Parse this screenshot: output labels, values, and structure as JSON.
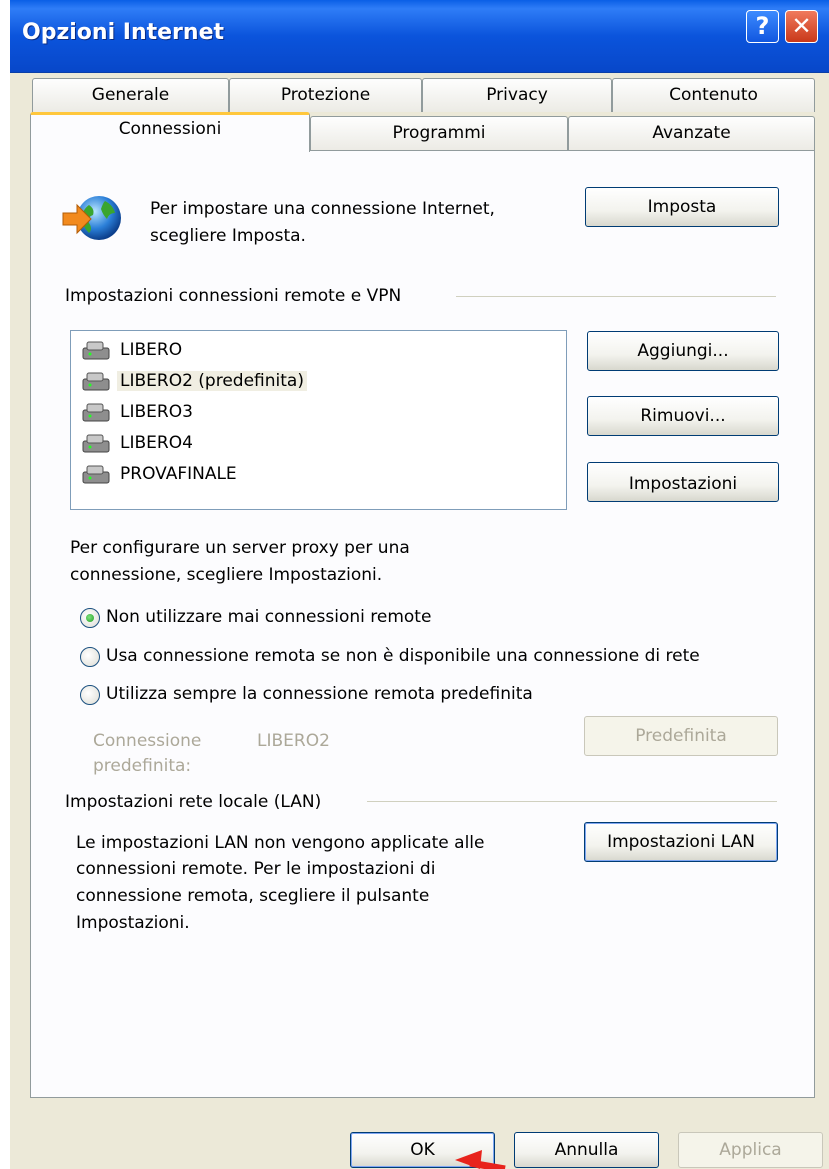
{
  "window": {
    "title": "Opzioni Internet",
    "help_glyph": "?",
    "close_glyph": "✕"
  },
  "tabs": {
    "row1": [
      "Generale",
      "Protezione",
      "Privacy",
      "Contenuto"
    ],
    "row2": [
      "Connessioni",
      "Programmi",
      "Avanzate"
    ],
    "active": "Connessioni"
  },
  "setup": {
    "text_line1": "Per impostare una connessione Internet,",
    "text_line2": "scegliere Imposta.",
    "button": "Imposta"
  },
  "dialup": {
    "group_label": "Impostazioni connessioni remote e VPN",
    "connections": [
      "LIBERO",
      "LIBERO2 (predefinita)",
      "LIBERO3",
      "LIBERO4",
      "PROVAFINALE"
    ],
    "selected": "LIBERO2 (predefinita)",
    "add_button": "Aggiungi...",
    "remove_button": "Rimuovi...",
    "settings_button": "Impostazioni"
  },
  "proxy": {
    "text_line1": "Per configurare un server proxy per una",
    "text_line2": "connessione, scegliere Impostazioni."
  },
  "radio_options": [
    "Non utilizzare mai connessioni remote",
    "Usa connessione remota se non è disponibile una connessione di rete",
    "Utilizza sempre la connessione remota predefinita"
  ],
  "radio_selected": "Non utilizzare mai connessioni remote",
  "default_connection": {
    "label_line1": "Connessione",
    "label_line2": "predefinita:",
    "value": "LIBERO2",
    "button": "Predefinita"
  },
  "lan": {
    "group_label": "Impostazioni rete locale (LAN)",
    "text_lines": [
      "Le impostazioni LAN non vengono applicate alle",
      "connessioni remote. Per le impostazioni di",
      "connessione remota, scegliere il pulsante",
      "Impostazioni."
    ],
    "button": "Impostazioni LAN"
  },
  "footer": {
    "ok": "OK",
    "cancel": "Annulla",
    "apply": "Applica"
  },
  "colors": {
    "titlebar": "#0b54dc",
    "dialog_bg": "#ece9d8",
    "panel_bg": "#fcfcfe",
    "tab_highlight": "#ffc73c",
    "annotation_arrow": "#e8231c"
  },
  "icons": {
    "setup": "globe-arrow-icon",
    "connection": "dialup-modem-icon",
    "annotation": "red-arrow-icon"
  }
}
